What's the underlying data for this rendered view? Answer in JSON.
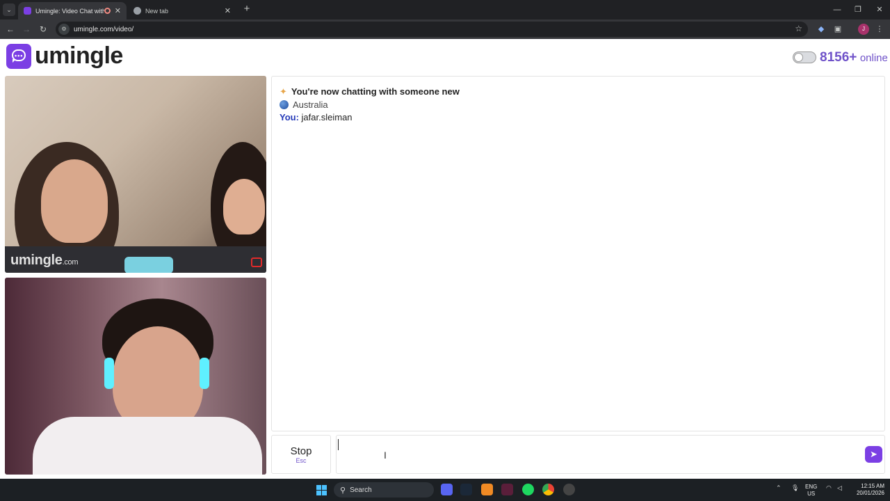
{
  "browser": {
    "tabs": [
      {
        "title": "Umingle: Video Chat with S",
        "active": true
      },
      {
        "title": "New tab",
        "active": false
      }
    ],
    "url": "umingle.com/video/",
    "profile_initial": "J"
  },
  "header": {
    "logo_text": "umingle",
    "online_count": "8156+",
    "online_label": "online"
  },
  "video": {
    "watermark_main": "umingle",
    "watermark_suffix": ".com"
  },
  "chat": {
    "system_message": "You're now chatting with someone new",
    "country": "Australia",
    "you_label": "You:",
    "you_value": "jafar.sleiman"
  },
  "controls": {
    "stop_label": "Stop",
    "stop_shortcut": "Esc",
    "message_placeholder": ""
  },
  "taskbar": {
    "search_label": "Search",
    "lang_line1": "ENG",
    "lang_line2": "US",
    "time": "12:15 AM",
    "date": "20/01/2026"
  },
  "colors": {
    "brand": "#7b3fe4",
    "online_text": "#6f52c9",
    "you_label": "#2439b8"
  }
}
